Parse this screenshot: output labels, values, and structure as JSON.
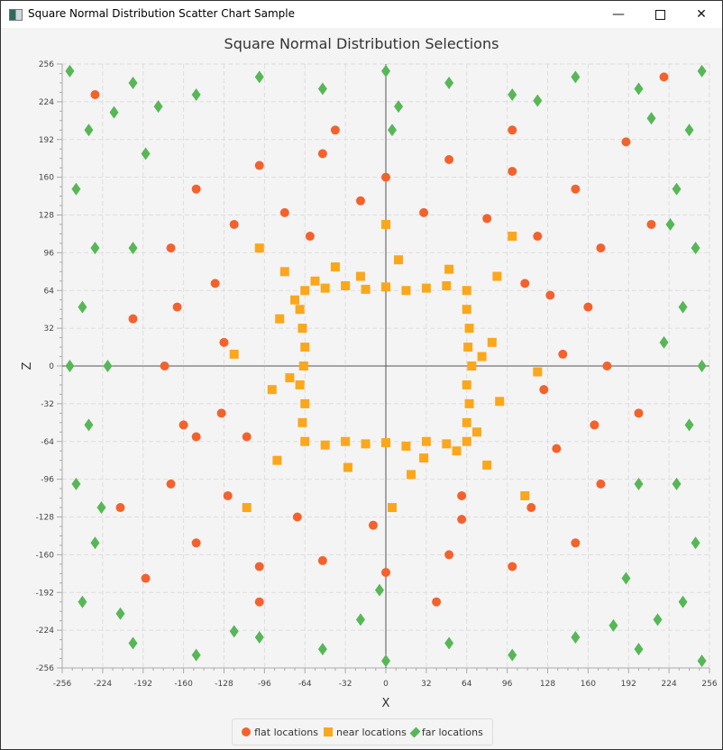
{
  "window": {
    "title": "Square Normal Distribution Scatter Chart Sample",
    "controls": [
      "minimize",
      "maximize",
      "close"
    ]
  },
  "colors": {
    "flat": "#f3622d",
    "near": "#fba71b",
    "far": "#57b757",
    "background": "#f4f4f4"
  },
  "chart_data": {
    "type": "scatter",
    "title": "Square Normal Distribution Selections",
    "xlabel": "X",
    "ylabel": "Z",
    "xlim": [
      -256,
      256
    ],
    "ylim": [
      -256,
      256
    ],
    "xticks": [
      -256,
      -224,
      -192,
      -160,
      -128,
      -96,
      -64,
      -32,
      0,
      32,
      64,
      96,
      128,
      160,
      192,
      224,
      256
    ],
    "yticks": [
      -256,
      -224,
      -192,
      -160,
      -128,
      -96,
      -64,
      -32,
      0,
      32,
      64,
      96,
      128,
      160,
      192,
      224,
      256
    ],
    "grid": true,
    "legend_placement": "bottom",
    "series": [
      {
        "name": "flat locations",
        "marker": "circle",
        "color": "#f3622d",
        "points": [
          [
            -150,
            150
          ],
          [
            -100,
            170
          ],
          [
            -50,
            180
          ],
          [
            0,
            160
          ],
          [
            50,
            175
          ],
          [
            100,
            165
          ],
          [
            150,
            150
          ],
          [
            170,
            100
          ],
          [
            160,
            50
          ],
          [
            175,
            0
          ],
          [
            165,
            -50
          ],
          [
            170,
            -100
          ],
          [
            150,
            -150
          ],
          [
            100,
            -170
          ],
          [
            50,
            -160
          ],
          [
            0,
            -175
          ],
          [
            -50,
            -165
          ],
          [
            -100,
            -170
          ],
          [
            -150,
            -150
          ],
          [
            -170,
            -100
          ],
          [
            -160,
            -50
          ],
          [
            -175,
            0
          ],
          [
            -165,
            50
          ],
          [
            -170,
            100
          ],
          [
            -120,
            120
          ],
          [
            -80,
            130
          ],
          [
            -20,
            140
          ],
          [
            30,
            130
          ],
          [
            80,
            125
          ],
          [
            120,
            110
          ],
          [
            130,
            60
          ],
          [
            125,
            -20
          ],
          [
            135,
            -70
          ],
          [
            115,
            -120
          ],
          [
            60,
            -130
          ],
          [
            -10,
            -135
          ],
          [
            -70,
            -128
          ],
          [
            -125,
            -110
          ],
          [
            -130,
            -40
          ],
          [
            -128,
            20
          ],
          [
            -135,
            70
          ],
          [
            -200,
            40
          ],
          [
            200,
            -40
          ],
          [
            -40,
            200
          ],
          [
            40,
            -200
          ],
          [
            -230,
            230
          ],
          [
            220,
            245
          ],
          [
            -190,
            -180
          ],
          [
            190,
            190
          ],
          [
            -210,
            -120
          ],
          [
            210,
            120
          ],
          [
            -100,
            -200
          ],
          [
            100,
            200
          ],
          [
            -150,
            -60
          ],
          [
            140,
            10
          ],
          [
            -60,
            110
          ],
          [
            60,
            -110
          ],
          [
            -110,
            -60
          ],
          [
            110,
            70
          ]
        ]
      },
      {
        "name": "near locations",
        "marker": "square",
        "color": "#fba71b",
        "points": [
          [
            -64,
            64
          ],
          [
            -48,
            66
          ],
          [
            -32,
            68
          ],
          [
            -16,
            65
          ],
          [
            0,
            67
          ],
          [
            16,
            64
          ],
          [
            32,
            66
          ],
          [
            48,
            68
          ],
          [
            64,
            64
          ],
          [
            64,
            48
          ],
          [
            66,
            32
          ],
          [
            65,
            16
          ],
          [
            68,
            0
          ],
          [
            64,
            -16
          ],
          [
            66,
            -32
          ],
          [
            64,
            -48
          ],
          [
            64,
            -64
          ],
          [
            48,
            -66
          ],
          [
            32,
            -64
          ],
          [
            16,
            -68
          ],
          [
            0,
            -65
          ],
          [
            -16,
            -66
          ],
          [
            -32,
            -64
          ],
          [
            -48,
            -67
          ],
          [
            -64,
            -64
          ],
          [
            -66,
            -48
          ],
          [
            -64,
            -32
          ],
          [
            -68,
            -16
          ],
          [
            -65,
            0
          ],
          [
            -64,
            16
          ],
          [
            -66,
            32
          ],
          [
            -68,
            48
          ],
          [
            -80,
            80
          ],
          [
            -40,
            84
          ],
          [
            10,
            90
          ],
          [
            50,
            82
          ],
          [
            88,
            76
          ],
          [
            84,
            20
          ],
          [
            90,
            -30
          ],
          [
            80,
            -84
          ],
          [
            20,
            -92
          ],
          [
            -30,
            -86
          ],
          [
            -86,
            -80
          ],
          [
            -90,
            -20
          ],
          [
            -84,
            40
          ],
          [
            -100,
            100
          ],
          [
            100,
            110
          ],
          [
            110,
            -110
          ],
          [
            -110,
            -120
          ],
          [
            -120,
            10
          ],
          [
            120,
            -5
          ],
          [
            0,
            120
          ],
          [
            5,
            -120
          ],
          [
            -56,
            72
          ],
          [
            72,
            -56
          ],
          [
            -72,
            56
          ],
          [
            56,
            -72
          ],
          [
            -20,
            76
          ],
          [
            30,
            -78
          ],
          [
            76,
            8
          ],
          [
            -76,
            -10
          ]
        ]
      },
      {
        "name": "far locations",
        "marker": "diamond",
        "color": "#57b757",
        "points": [
          [
            -250,
            250
          ],
          [
            -200,
            240
          ],
          [
            -150,
            230
          ],
          [
            -100,
            245
          ],
          [
            -50,
            235
          ],
          [
            0,
            250
          ],
          [
            50,
            240
          ],
          [
            100,
            230
          ],
          [
            150,
            245
          ],
          [
            200,
            235
          ],
          [
            250,
            250
          ],
          [
            240,
            200
          ],
          [
            230,
            150
          ],
          [
            245,
            100
          ],
          [
            235,
            50
          ],
          [
            250,
            0
          ],
          [
            240,
            -50
          ],
          [
            230,
            -100
          ],
          [
            245,
            -150
          ],
          [
            235,
            -200
          ],
          [
            250,
            -250
          ],
          [
            200,
            -240
          ],
          [
            150,
            -230
          ],
          [
            100,
            -245
          ],
          [
            50,
            -235
          ],
          [
            0,
            -250
          ],
          [
            -50,
            -240
          ],
          [
            -100,
            -230
          ],
          [
            -150,
            -245
          ],
          [
            -200,
            -235
          ],
          [
            -240,
            -200
          ],
          [
            -230,
            -150
          ],
          [
            -245,
            -100
          ],
          [
            -235,
            -50
          ],
          [
            -250,
            0
          ],
          [
            -240,
            50
          ],
          [
            -230,
            100
          ],
          [
            -245,
            150
          ],
          [
            -235,
            200
          ],
          [
            -215,
            215
          ],
          [
            215,
            -215
          ],
          [
            -210,
            -210
          ],
          [
            210,
            210
          ],
          [
            -220,
            0
          ],
          [
            220,
            20
          ],
          [
            10,
            220
          ],
          [
            -20,
            -215
          ],
          [
            -180,
            220
          ],
          [
            180,
            -220
          ],
          [
            -225,
            -120
          ],
          [
            225,
            120
          ],
          [
            -120,
            -225
          ],
          [
            120,
            225
          ],
          [
            -200,
            100
          ],
          [
            200,
            -100
          ],
          [
            190,
            -180
          ],
          [
            -190,
            180
          ],
          [
            5,
            200
          ],
          [
            -5,
            -190
          ]
        ]
      }
    ]
  }
}
